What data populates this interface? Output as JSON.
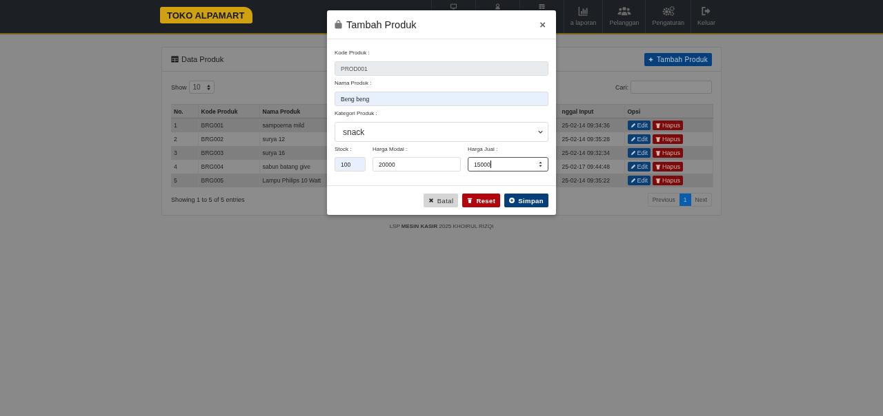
{
  "navbar": {
    "logo": "TOKO ALPAMART",
    "items": [
      {
        "kind": "icon"
      },
      {
        "kind": "icon"
      },
      {
        "kind": "icon"
      },
      {
        "kind": "labeled",
        "label": "a laporan"
      },
      {
        "kind": "labeled",
        "label": "Pelanggan"
      },
      {
        "kind": "labeled",
        "label": "Pengaturan"
      },
      {
        "kind": "labeled",
        "label": "Keluar"
      }
    ]
  },
  "card": {
    "title": "Data Produk",
    "add_button": "Tambah Produk",
    "show_label": "Show",
    "page_size": "10",
    "search_label": "Cari:",
    "table": {
      "columns": [
        "No.",
        "Kode Produk",
        "Nama Produk",
        "nggal Input",
        "Opsi"
      ],
      "rows": [
        {
          "no": "1",
          "kode": "BRG001",
          "nama": "sampoerna mild",
          "tanggal": "25-02-14 09:34:36",
          "edit": "Edit",
          "hapus": "Hapus"
        },
        {
          "no": "2",
          "kode": "BRG002",
          "nama": "surya 12",
          "tanggal": "25-02-14 09:35:28",
          "edit": "Edit",
          "hapus": "Hapus"
        },
        {
          "no": "3",
          "kode": "BRG003",
          "nama": "surya 16",
          "tanggal": "25-02-14 09:32:34",
          "edit": "Edit",
          "hapus": "Hapus"
        },
        {
          "no": "4",
          "kode": "BRG004",
          "nama": "sabun batang give",
          "tanggal": "25-02-17 09:44:48",
          "edit": "Edit",
          "hapus": "Hapus"
        },
        {
          "no": "5",
          "kode": "BRG005",
          "nama": "Lampu Philips 10 Watt",
          "tanggal": "25-02-14 09:35:22",
          "edit": "Edit",
          "hapus": "Hapus"
        }
      ]
    },
    "info": "Showing 1 to 5 of 5 entries",
    "pagination": [
      {
        "label": "Previous",
        "selected": false
      },
      {
        "label": "1",
        "selected": true
      },
      {
        "label": "Next",
        "selected": false
      }
    ]
  },
  "footer": "LSP **MESIN KASIR** 2025 KHOIRUL RIZQI",
  "modal": {
    "title": "Tambah Produk",
    "close": "×",
    "kode": {
      "label": "Kode Produk :",
      "value": "PROD001",
      "disabled": true
    },
    "nama": {
      "label": "Nama Produk :",
      "value": "Beng beng",
      "autofilled": true
    },
    "kategori": {
      "label": "Kategori Produk :",
      "value": "snack"
    },
    "stock": {
      "label": "Stock :",
      "value": "100",
      "autofilled": true
    },
    "harga_modal": {
      "label": "Harga Modal :",
      "value": "20000",
      "autofilled": false
    },
    "harga_jual": {
      "label": "Harga Jual :",
      "value": "15000",
      "focused": true
    },
    "buttons": [
      {
        "kind": "cancel",
        "label": "Batal"
      },
      {
        "kind": "reset",
        "label": "Reset"
      },
      {
        "kind": "save",
        "label": "Simpan"
      }
    ]
  }
}
